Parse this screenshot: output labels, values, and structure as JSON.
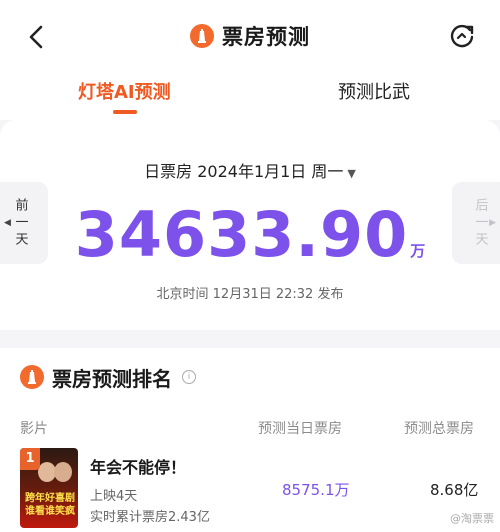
{
  "header": {
    "title": "票房预测",
    "back_icon": "chevron-left-icon",
    "refresh_icon": "refresh-icon"
  },
  "tabs": [
    {
      "label": "灯塔AI预测",
      "active": true
    },
    {
      "label": "预测比武",
      "active": false
    }
  ],
  "hero": {
    "date_label": "日票房",
    "date": "2024年1月1日",
    "weekday": "周一",
    "value": "34633.90",
    "unit": "万",
    "publish": "北京时间 12月31日 22:32 发布",
    "prev_day": "前一天",
    "next_day": "后一天"
  },
  "ranking": {
    "title": "票房预测排名",
    "columns": [
      "影片",
      "预测当日票房",
      "预测总票房"
    ],
    "rows": [
      {
        "rank": "1",
        "name": "年会不能停！",
        "days": "上映4天",
        "cumulative": "实时累计票房2.43亿",
        "day_forecast": "8575.1万",
        "total_forecast": "8.68亿",
        "poster_text": "跨年好喜剧 谁看谁笑疯"
      }
    ]
  },
  "watermark": "@淘票票",
  "colors": {
    "accent_orange": "#ef5a23",
    "value_purple": "#7d52ea",
    "background_gray": "#f5f5f8"
  }
}
